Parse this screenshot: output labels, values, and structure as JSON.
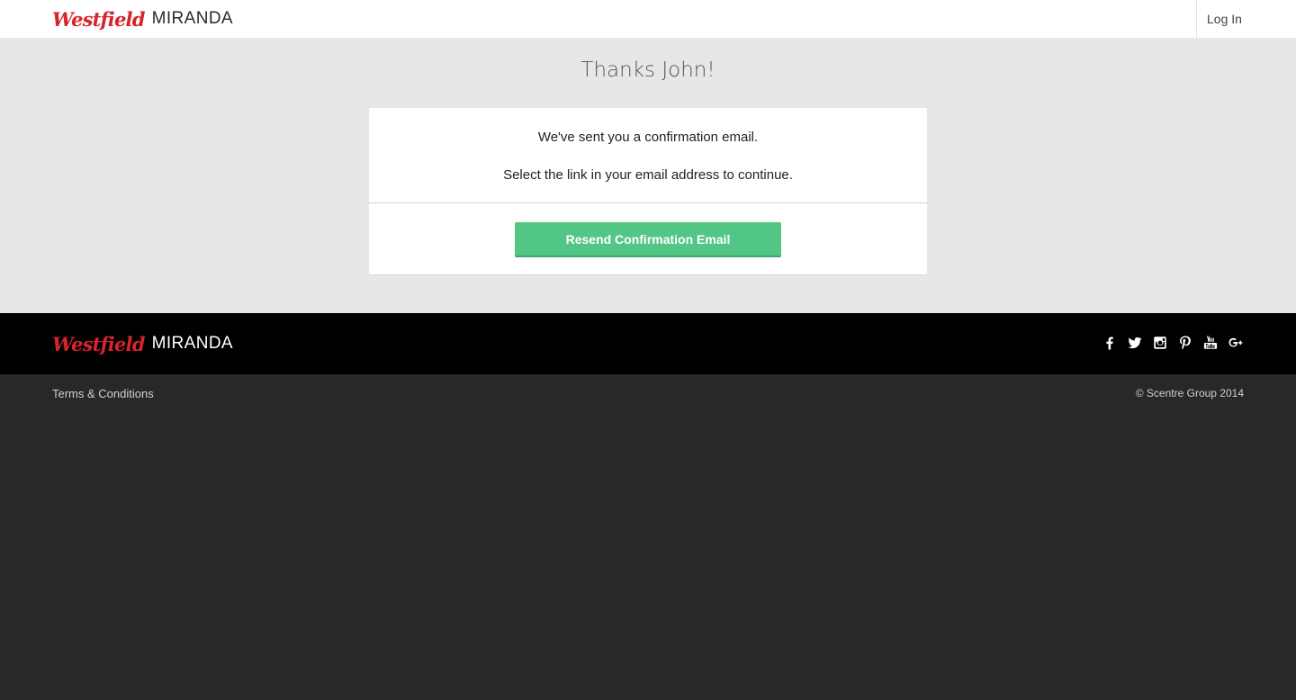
{
  "header": {
    "brand_script": "Westfield",
    "brand_name": "MIRANDA",
    "login_label": "Log In"
  },
  "main": {
    "title": "Thanks John!",
    "message_line1": "We've sent you a confirmation email.",
    "message_line2": "Select the link in your email address to continue.",
    "resend_button_label": "Resend Confirmation Email"
  },
  "footer": {
    "brand_script": "Westfield",
    "brand_name": "MIRANDA",
    "social_icons": [
      "facebook-icon",
      "twitter-icon",
      "instagram-icon",
      "pinterest-icon",
      "youtube-icon",
      "google-plus-icon"
    ],
    "terms_label": "Terms & Conditions",
    "copyright": "© Scentre Group 2014"
  },
  "colors": {
    "brand_red": "#d7242c",
    "button_green": "#52c684",
    "page_background": "#e7e7e7",
    "footer_black": "#000000",
    "footer_dark": "#28282a"
  }
}
